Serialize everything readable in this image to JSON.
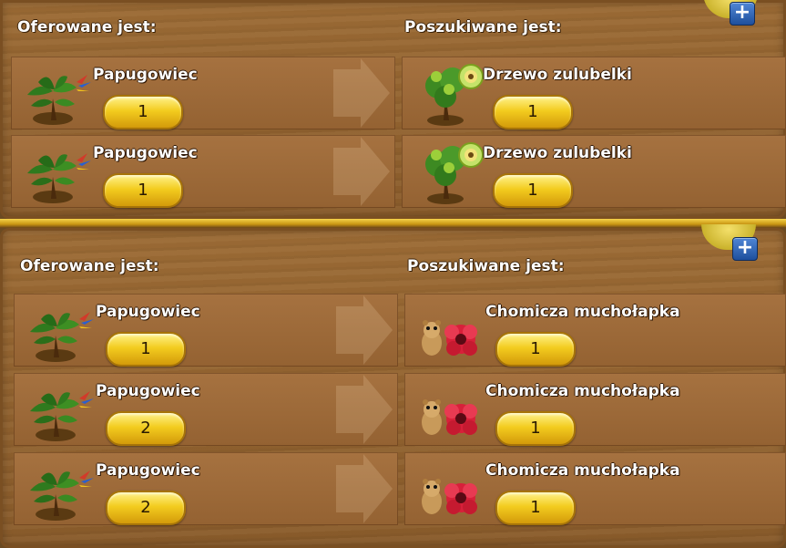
{
  "panels": [
    {
      "offered_label": "Oferowane jest:",
      "wanted_label": "Poszukiwane jest:",
      "rows": [
        {
          "offered_name": "Papugowiec",
          "offered_qty": "1",
          "wanted_name": "Drzewo zulubelki",
          "wanted_qty": "1"
        },
        {
          "offered_name": "Papugowiec",
          "offered_qty": "1",
          "wanted_name": "Drzewo zulubelki",
          "wanted_qty": "1"
        }
      ]
    },
    {
      "offered_label": "Oferowane jest:",
      "wanted_label": "Poszukiwane jest:",
      "rows": [
        {
          "offered_name": "Papugowiec",
          "offered_qty": "1",
          "wanted_name": "Chomicza muchołapka",
          "wanted_qty": "1"
        },
        {
          "offered_name": "Papugowiec",
          "offered_qty": "2",
          "wanted_name": "Chomicza muchołapka",
          "wanted_qty": "1"
        },
        {
          "offered_name": "Papugowiec",
          "offered_qty": "2",
          "wanted_name": "Chomicza muchołapka",
          "wanted_qty": "1"
        }
      ]
    }
  ],
  "icons": {
    "offered_item": "parrot-tree-icon",
    "wanted_item_panel_1": "fruit-tree-icon",
    "wanted_item_panel_2": "hamster-flytrap-icon",
    "add": "plus-icon",
    "trade_direction": "arrow-right-icon"
  },
  "colors": {
    "quantity_pill": "#f3cc1f",
    "plus_button": "#2f66b8",
    "wood": "#9c6b35"
  }
}
